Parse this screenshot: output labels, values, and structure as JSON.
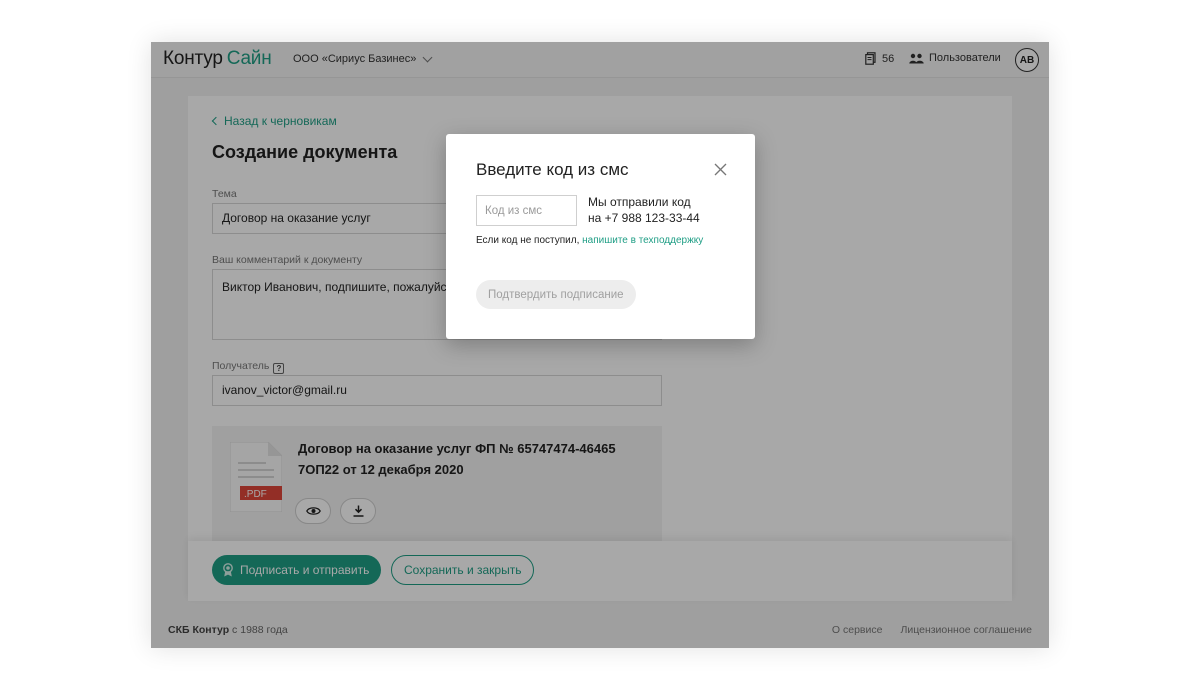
{
  "header": {
    "logo_part1": "Контур",
    "logo_part2": "Сайн",
    "org_name": "ООО «Сириус Базинес»",
    "docs_count": "56",
    "users_label": "Пользователи",
    "avatar_initials": "АВ"
  },
  "page": {
    "back_label": "Назад к черновикам",
    "title": "Создание документа",
    "topic_label": "Тема",
    "topic_value": "Договор на оказание услуг",
    "comment_label": "Ваш комментарий к документу",
    "comment_value": "Виктор Иванович, подпишите, пожалуйста",
    "recipient_label": "Получатель",
    "recipient_help": "?",
    "recipient_value": "ivanov_victor@gmail.ru",
    "attachment_title": "Договор на оказание услуг ФП № 65747474-46465 7ОП22 от 12 декабря 2020",
    "attachment_badge": ".PDF",
    "sign_send_label": "Подписать и отправить",
    "save_close_label": "Сохранить и закрыть"
  },
  "footer": {
    "company": "СКБ Контур",
    "since": " с 1988 года",
    "about": "О сервисе",
    "license": "Лицензионное соглашение"
  },
  "modal": {
    "title": "Введите код из смс",
    "code_placeholder": "Код из смс",
    "sent_line1": "Мы отправили код",
    "sent_line2": "на +7 988 123-33-44",
    "no_code_text": "Если код не поступил, ",
    "support_link": "напишите в техподдержку",
    "confirm_label": "Подтвердить подписание"
  },
  "colors": {
    "accent": "#1f9e85",
    "pdf_badge": "#e0463a",
    "overlay": "rgba(0,0,0,0.34)"
  }
}
